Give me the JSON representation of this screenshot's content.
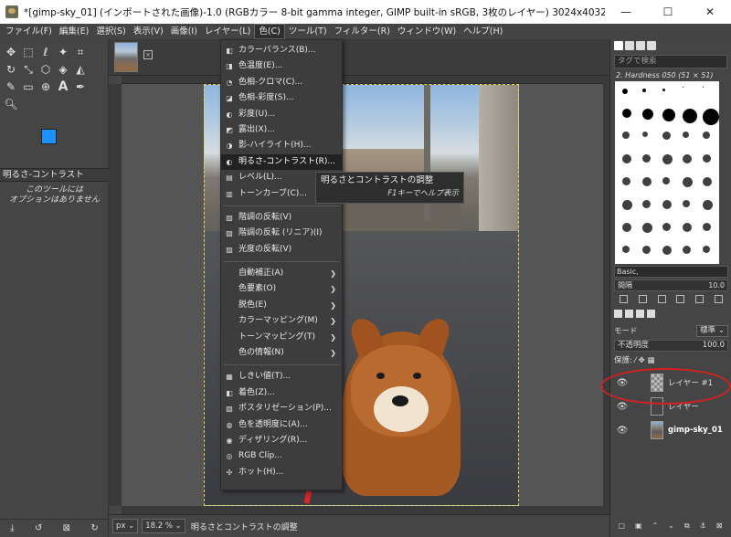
{
  "window": {
    "title": "*[gimp-sky_01] (インポートされた画像)-1.0 (RGBカラー 8-bit gamma integer, GIMP built-in sRGB, 3枚のレイヤー) 3024x4032 – GIMP",
    "minimize": "—",
    "maximize": "☐",
    "close": "✕"
  },
  "menubar": [
    "ファイル(F)",
    "編集(E)",
    "選択(S)",
    "表示(V)",
    "画像(I)",
    "レイヤー(L)",
    "色(C)",
    "ツール(T)",
    "フィルター(R)",
    "ウィンドウ(W)",
    "ヘルプ(H)"
  ],
  "toolbox": {
    "options_title": "明るさ-コントラスト",
    "options_message_line1": "このツールには",
    "options_message_line2": "オプションはありません"
  },
  "color_menu": {
    "group1": [
      {
        "label": "カラーバランス(B)...",
        "icon": "◧"
      },
      {
        "label": "色温度(E)...",
        "icon": "◨"
      },
      {
        "label": "色相-クロマ(C)...",
        "icon": "◔"
      },
      {
        "label": "色相-彩度(S)...",
        "icon": "◪"
      },
      {
        "label": "彩度(U)...",
        "icon": "◐"
      },
      {
        "label": "露出(X)...",
        "icon": "◩"
      },
      {
        "label": "影-ハイライト(H)...",
        "icon": "◑"
      },
      {
        "label": "明るさ-コントラスト(R)...",
        "icon": "◐",
        "highlighted": true
      },
      {
        "label": "レベル(L)...",
        "icon": "▤"
      },
      {
        "label": "トーンカーブ(C)...",
        "icon": "▥"
      }
    ],
    "group2": [
      {
        "label": "階調の反転(V)",
        "icon": "▨"
      },
      {
        "label": "階調の反転 (リニア)(I)",
        "icon": "▨"
      },
      {
        "label": "光度の反転(V)",
        "icon": "▨"
      }
    ],
    "group3": [
      {
        "label": "自動補正(A)"
      },
      {
        "label": "色要素(O)"
      },
      {
        "label": "脱色(E)"
      },
      {
        "label": "カラーマッピング(M)"
      },
      {
        "label": "トーンマッピング(T)"
      },
      {
        "label": "色の情報(N)"
      }
    ],
    "group4": [
      {
        "label": "しきい値(T)...",
        "icon": "▦"
      },
      {
        "label": "着色(Z)...",
        "icon": "◧"
      },
      {
        "label": "ポスタリゼーション(P)...",
        "icon": "▧"
      },
      {
        "label": "色を透明度に(A)...",
        "icon": "◍"
      },
      {
        "label": "ディザリング(R)...",
        "icon": "◉"
      },
      {
        "label": "RGB Clip...",
        "icon": "◎"
      },
      {
        "label": "ホット(H)...",
        "icon": "✣"
      }
    ],
    "submenu_arrow": "❯"
  },
  "tooltip": {
    "title": "明るさとコントラストの調整",
    "help": "F1キーでヘルプ表示"
  },
  "statusbar": {
    "unit": "px",
    "zoom": "18.2 %",
    "message": "明るさとコントラストの調整"
  },
  "dock": {
    "tag_placeholder": "タグで検索",
    "brush_name": "2. Hardness 050 (51 × 51)",
    "brush_preset": "Basic,",
    "spacing_label": "間隔",
    "spacing_value": "10.0",
    "mode_label": "モード",
    "mode_value": "標準 ⌄",
    "opacity_label": "不透明度",
    "opacity_value": "100.0",
    "lock_label": "保護: ⁄ ✥ ▦",
    "layers": [
      {
        "name": "レイヤー #1"
      },
      {
        "name": "レイヤー"
      },
      {
        "name": "gimp-sky_01"
      }
    ]
  }
}
